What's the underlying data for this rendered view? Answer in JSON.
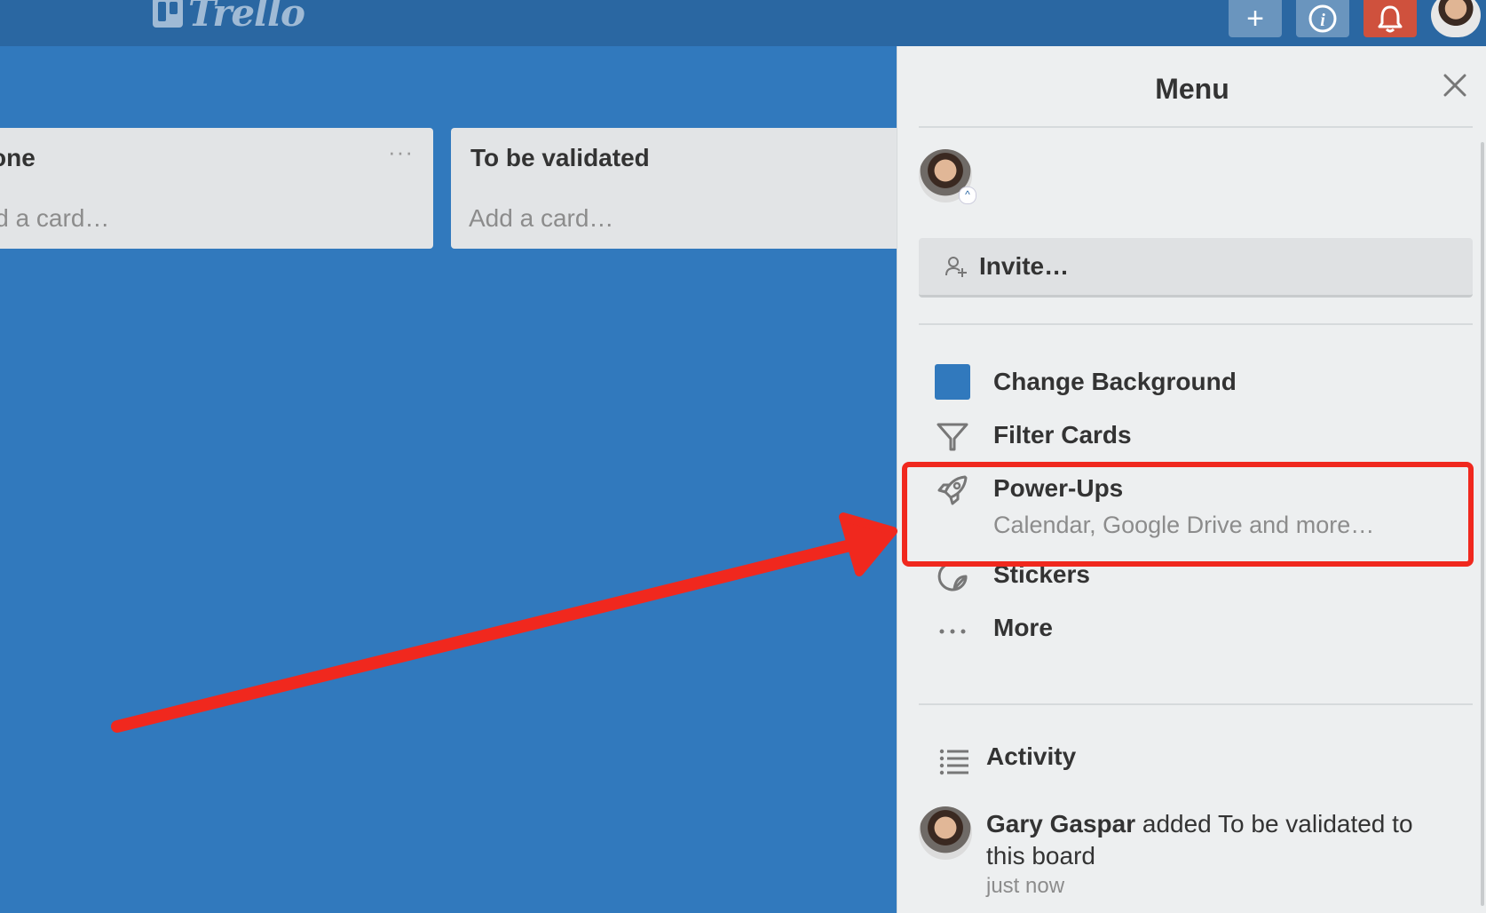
{
  "app": {
    "logo_text": "Trello"
  },
  "header": {
    "buttons": [
      "add-button",
      "info-button",
      "notifications-button",
      "member-avatar"
    ],
    "add_symbol": "+",
    "info_symbol": "i",
    "bell_color": "#cf513d"
  },
  "board": {
    "background_color": "#3179bd",
    "lists": [
      {
        "title": "one",
        "add_card": "ld a card…",
        "menu": "···"
      },
      {
        "title": "To be validated",
        "add_card": "Add a card…",
        "menu": "···"
      }
    ]
  },
  "menu": {
    "title": "Menu",
    "invite_label": "Invite…",
    "items": [
      {
        "label": "Change Background",
        "icon": "background-swatch-icon"
      },
      {
        "label": "Filter Cards",
        "icon": "filter-icon"
      },
      {
        "label": "Power-Ups",
        "subtitle": "Calendar, Google Drive and more…",
        "icon": "rocket-icon"
      },
      {
        "label": "Stickers",
        "icon": "sticker-icon"
      },
      {
        "label": "More",
        "icon": "ellipsis-icon"
      }
    ],
    "activity": {
      "label": "Activity",
      "entries": [
        {
          "user": "Gary Gaspar",
          "action": " added To be validated to this board",
          "time": "just now"
        }
      ]
    }
  },
  "annotation": {
    "highlight_color": "#f0281e",
    "target": "Power-Ups"
  }
}
